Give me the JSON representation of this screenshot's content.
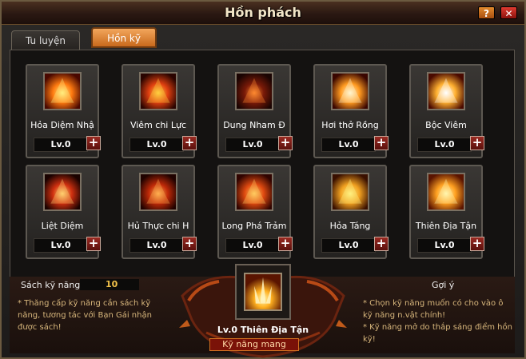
{
  "window": {
    "title": "Hồn phách",
    "help_label": "?",
    "close_label": "✕"
  },
  "tabs": [
    {
      "label": "Tu luyện",
      "active": false
    },
    {
      "label": "Hồn kỹ",
      "active": true
    }
  ],
  "skills": [
    {
      "name": "Hỏa Diệm Nhậ",
      "level": "Lv.0",
      "icon": "flame-slash-icon"
    },
    {
      "name": "Viêm chi Lực",
      "level": "Lv.0",
      "icon": "fire-swirl-icon"
    },
    {
      "name": "Dung Nham Đ",
      "level": "Lv.0",
      "icon": "lava-figure-icon"
    },
    {
      "name": "Hơi thở Rồng",
      "level": "Lv.0",
      "icon": "dragon-breath-icon"
    },
    {
      "name": "Bộc Viêm",
      "level": "Lv.0",
      "icon": "fire-burst-icon"
    },
    {
      "name": "Liệt Diệm",
      "level": "Lv.0",
      "icon": "fire-wall-icon"
    },
    {
      "name": "Hủ Thực chi H",
      "level": "Lv.0",
      "icon": "corrosion-fire-icon"
    },
    {
      "name": "Long Phá Trảm",
      "level": "Lv.0",
      "icon": "dragon-slash-icon"
    },
    {
      "name": "Hỏa Táng",
      "level": "Lv.0",
      "icon": "cremation-sword-icon"
    },
    {
      "name": "Thiên Địa Tận",
      "level": "Lv.0",
      "icon": "pillar-flame-icon"
    }
  ],
  "plus_label": "+",
  "book": {
    "label": "Sách kỹ năng:",
    "value": "10"
  },
  "note_left": "* Thăng cấp kỹ năng cần sách kỹ năng, tương tác với Bạn Gái nhận được sách!",
  "hint": {
    "title": "Gợi ý",
    "text": "* Chọn kỹ năng muốn có cho vào ô kỹ năng n.vật chính!\n* Kỹ năng mở do thắp sáng điểm hồn kỹ!"
  },
  "selected": {
    "name": "Lv.0 Thiên Địa Tận",
    "sub_label": "Kỹ năng mang",
    "icon": "pillar-flame-icon"
  },
  "colors": {
    "accent": "#c8691c",
    "gold": "#f2c24a",
    "note": "#d7b67c",
    "danger": "#9a2a22"
  }
}
